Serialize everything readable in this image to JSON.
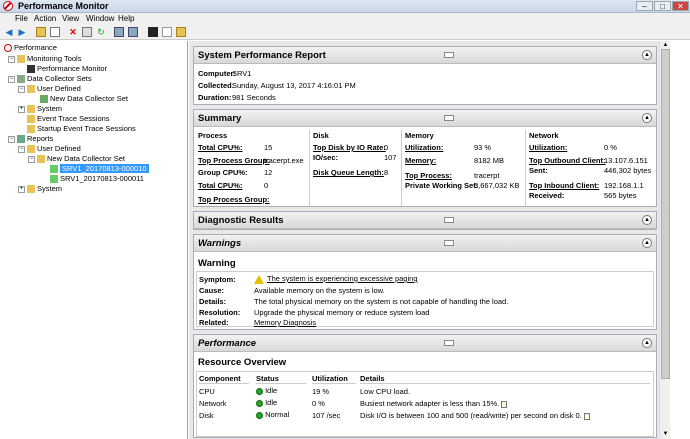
{
  "window": {
    "title": "Performance Monitor",
    "min": "–",
    "max": "□",
    "close": "✕"
  },
  "menu": [
    "File",
    "Action",
    "View",
    "Window",
    "Help"
  ],
  "tree": {
    "root": "Performance",
    "monitoring_tools": "Monitoring Tools",
    "performance_monitor": "Performance Monitor",
    "data_collector_sets": "Data Collector Sets",
    "user_defined": "User Defined",
    "new_dcs": "New Data Collector Set",
    "system": "System",
    "event_trace": "Event Trace Sessions",
    "startup_trace": "Startup Event Trace Sessions",
    "reports": "Reports",
    "reports_user_defined": "User Defined",
    "reports_new_dcs": "New Data Collector Set",
    "report1": "SRV1_20170813-000010",
    "report2": "SRV1_20170813-000011",
    "reports_system": "System"
  },
  "report": {
    "title": "System Performance Report",
    "computer_label": "Computer:",
    "computer": "SRV1",
    "collected_label": "Collected:",
    "collected": "Sunday, August 13, 2017 4:16:01 PM",
    "duration_label": "Duration:",
    "duration": "981 Seconds"
  },
  "summary": {
    "title": "Summary",
    "process_h": "Process",
    "disk_h": "Disk",
    "memory_h": "Memory",
    "network_h": "Network",
    "total_cpu_l": "Total CPU%:",
    "total_cpu": "15",
    "top_proc_group_l": "Top Process Group:",
    "top_proc_group": "tracerpt.exe",
    "group_cpu_l": "Group CPU%:",
    "group_cpu": "12",
    "total_cpu2_l": "Total CPU%:",
    "total_cpu2": "0",
    "top_proc_group2_l": "Top Process Group:",
    "top_disk_l": "Top Disk by IO Rate:",
    "top_disk": "0",
    "io_sec_l": "IO/sec:",
    "io_sec": "107",
    "disk_queue_l": "Disk Queue Length:",
    "disk_queue": "8",
    "util_l": "Utilization:",
    "util": "93 %",
    "memory_l": "Memory:",
    "memory": "8182 MB",
    "top_process_l": "Top Process:",
    "top_process": "tracerpt",
    "pws_l": "Private Working Set:",
    "pws": "3,667,032 KB",
    "net_util_l": "Utilization:",
    "net_util": "0 %",
    "top_out_l": "Top Outbound Client:",
    "top_out": "13.107.6.151",
    "sent_l": "Sent:",
    "sent": "446,302 bytes",
    "top_in_l": "Top Inbound Client:",
    "top_in": "192.168.1.1",
    "received_l": "Received:",
    "received": "565 bytes"
  },
  "diagnostic": {
    "title": "Diagnostic Results",
    "warnings": "Warnings",
    "warning_h": "Warning",
    "symptom_l": "Symptom:",
    "symptom": "The system is experiencing excessive paging",
    "cause_l": "Cause:",
    "cause": "Available memory on the system is low.",
    "details_l": "Details:",
    "details": "The total physical memory on the system is not capable of handling the load.",
    "resolution_l": "Resolution:",
    "resolution": "Upgrade the physical memory or reduce system load",
    "related_l": "Related:",
    "related": "Memory Diagnosis"
  },
  "performance": {
    "title": "Performance"
  },
  "resource": {
    "title": "Resource Overview",
    "headers": [
      "Component",
      "Status",
      "Utilization",
      "Details"
    ],
    "rows": [
      {
        "component": "CPU",
        "status": "Idle",
        "util": "19 %",
        "details": "Low CPU load."
      },
      {
        "component": "Network",
        "status": "Idle",
        "util": "0 %",
        "details": "Busiest network adapter is less than 15%."
      },
      {
        "component": "Disk",
        "status": "Normal",
        "util": "107 /sec",
        "details": "Disk I/O is between 100 and 500 (read/write) per second on disk 0."
      }
    ]
  }
}
